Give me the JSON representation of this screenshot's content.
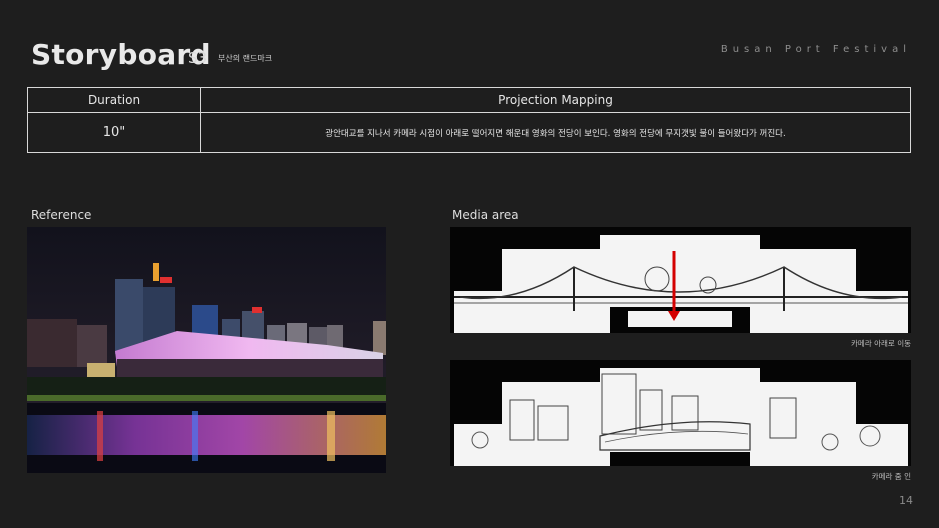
{
  "header": {
    "title": "Storyboard",
    "scene": "S3",
    "subtitle": "부산의 랜드마크",
    "brand": "Busan Port Festival"
  },
  "table": {
    "headers": [
      "Duration",
      "Projection Mapping"
    ],
    "duration": "10\"",
    "description": "광안대교를 지나서 카메라 시점이 아래로 떨어지면 해운대 영화의 전당이 보인다. 영화의 전당에 무지갯빛 불이 들어왔다가 꺼진다."
  },
  "reference": {
    "label": "Reference"
  },
  "media": {
    "label": "Media area",
    "panels": [
      {
        "caption": "카메라 아래로 이동"
      },
      {
        "caption": "카메라 줌 인"
      }
    ]
  },
  "page_number": "14",
  "colors": {
    "background": "#1e1e1e",
    "arrow": "#d40000",
    "panel": "#ffffff"
  }
}
